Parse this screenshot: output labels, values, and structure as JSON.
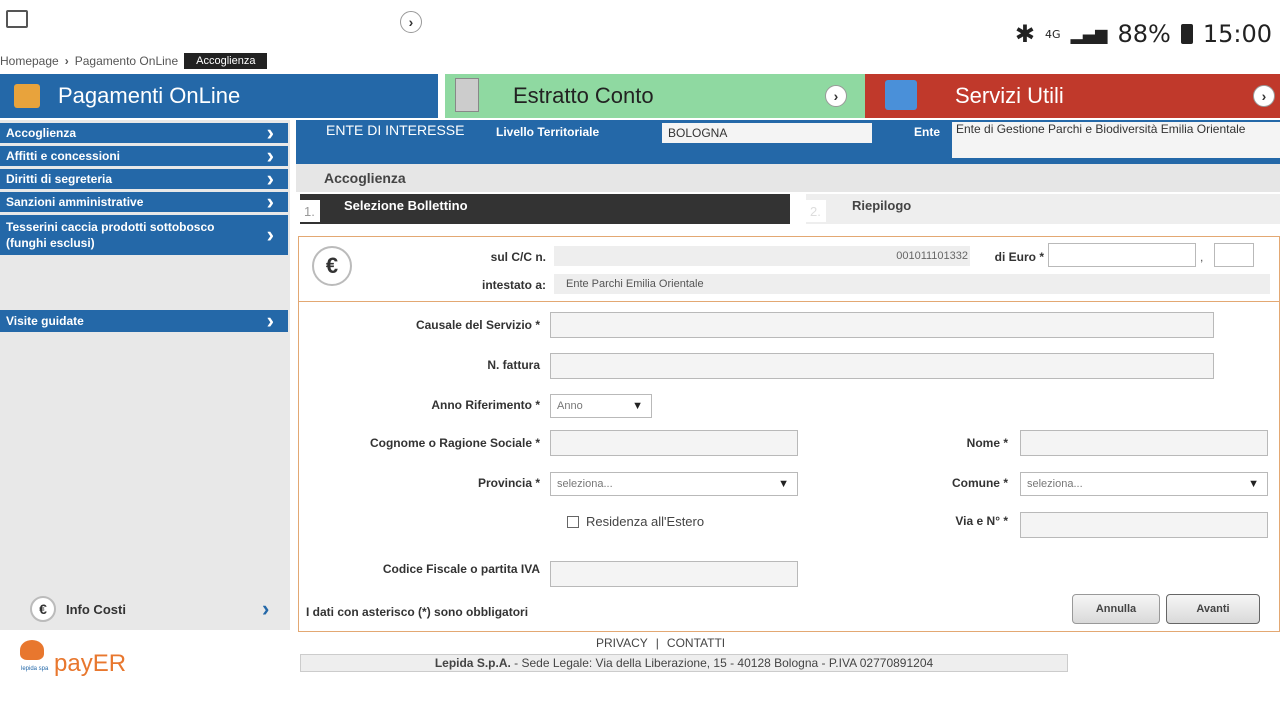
{
  "statusbar": {
    "battery": "88%",
    "time": "15:00",
    "network": "4G"
  },
  "breadcrumb": {
    "home": "Homepage",
    "section": "Pagamento OnLine",
    "current": "Accoglienza"
  },
  "topbar": {
    "payments": "Pagamenti OnLine",
    "statement": "Estratto Conto",
    "services": "Servizi Utili"
  },
  "sidebar": {
    "items": [
      {
        "label": "Accoglienza"
      },
      {
        "label": "Affitti e concessioni"
      },
      {
        "label": "Diritti di segreteria"
      },
      {
        "label": "Sanzioni amministrative"
      },
      {
        "label": "Tesserini caccia prodotti sottobosco (funghi esclusi)"
      },
      {
        "label": "Visite guidate"
      }
    ],
    "info_costi": "Info Costi"
  },
  "ente": {
    "header": "ENTE DI INTERESSE",
    "livello_label": "Livello Territoriale",
    "livello_value": "BOLOGNA",
    "ente_label": "Ente",
    "ente_value": "Ente di Gestione Parchi e Biodiversità Emilia Orientale"
  },
  "section_title": "Accoglienza",
  "steps": {
    "step1_num": "1.",
    "step1": "Selezione Bollettino",
    "step2_num": "2.",
    "step2": "Riepilogo"
  },
  "bollettino": {
    "cc_label": "sul C/C n.",
    "cc_value": "001011101332",
    "euro_label": "di Euro *",
    "intestato_label": "intestato a:",
    "intestato_value": "Ente Parchi Emilia Orientale",
    "comma": ","
  },
  "form": {
    "causale_label": "Causale del Servizio *",
    "fattura_label": "N. fattura",
    "anno_label": "Anno Riferimento  *",
    "anno_value": "Anno",
    "cognome_label": "Cognome o Ragione Sociale *",
    "nome_label": "Nome *",
    "provincia_label": "Provincia *",
    "provincia_value": "seleziona...",
    "comune_label": "Comune *",
    "comune_value": "seleziona...",
    "residenza_label": "Residenza all'Estero",
    "via_label": "Via e N° *",
    "cf_label": "Codice Fiscale o partita IVA",
    "required_note": "I dati con asterisco (*) sono obbligatori",
    "cancel": "Annulla",
    "next": "Avanti"
  },
  "footer": {
    "privacy": "PRIVACY",
    "separator": "|",
    "contatti": "CONTATTI",
    "company": "Lepida S.p.A.",
    "address": " - Sede Legale: Via della Liberazione, 15 - 40128 Bologna - P.IVA 02770891204",
    "logo": "payER",
    "logo_small": "lepida spa"
  }
}
